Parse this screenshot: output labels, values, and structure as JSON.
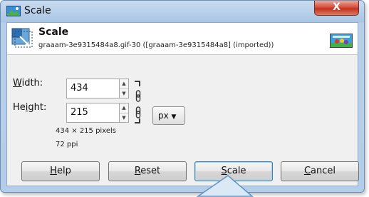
{
  "window": {
    "title": "Scale",
    "close_label": "X"
  },
  "header": {
    "title": "Scale",
    "subtitle": "graaam-3e9315484a8.gif-30 ([graaam-3e9315484a8] (imported))"
  },
  "form": {
    "width_label_mnemonic": "W",
    "width_label_rest": "idth:",
    "width_value": "434",
    "height_label_prefix": "He",
    "height_label_mnemonic": "i",
    "height_label_rest": "ght:",
    "height_value": "215",
    "unit": "px",
    "dimensions_text": "434 × 215 pixels",
    "resolution_text": "72 ppi"
  },
  "buttons": {
    "help_mnemonic": "H",
    "help_rest": "elp",
    "reset_mnemonic": "R",
    "reset_rest": "eset",
    "scale_mnemonic": "S",
    "scale_rest": "cale",
    "cancel_mnemonic": "C",
    "cancel_rest": "ancel"
  },
  "colors": {
    "titlebar_gradient_top": "#c9dcf0",
    "close_button": "#c2331f",
    "focus_border": "#3c7fb1",
    "header_background": "#ffffff"
  },
  "icons": {
    "app": "gimp-scale-icon",
    "header": "scale-image-icon",
    "chain": "chain-link-icon",
    "thumbnail": "image-thumbnail-icon"
  }
}
